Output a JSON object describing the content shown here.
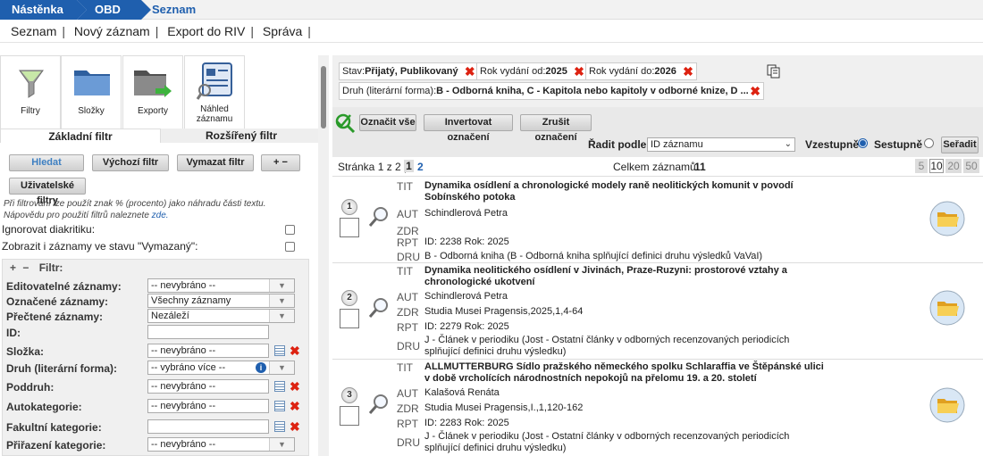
{
  "breadcrumb": [
    "Nástěnka",
    "OBD",
    "Seznam"
  ],
  "menu": [
    "Seznam",
    "Nový záznam",
    "Export do RIV",
    "Správa"
  ],
  "tiles": [
    {
      "label": "Filtry",
      "icon": "funnel-icon"
    },
    {
      "label": "Složky",
      "icon": "folder-icon"
    },
    {
      "label": "Exporty",
      "icon": "export-folder-icon"
    },
    {
      "label": "Náhled záznamu",
      "icon": "record-preview-icon"
    }
  ],
  "tabs": {
    "basic": "Základní filtr",
    "advanced": "Rozšířený filtr"
  },
  "buttons": {
    "search": "Hledat",
    "default_filter": "Výchozí filtr",
    "clear_filter": "Vymazat filtr",
    "plusminus": "+ −",
    "user_filters": "Uživatelské filtry"
  },
  "help": {
    "text": "Při filtrování lze použít znak % (procento) jako náhradu části textu. Nápovědu pro použití filtrů naleznete",
    "link": "zde."
  },
  "checks": [
    {
      "label": "Ignorovat diakritiku:"
    },
    {
      "label": "Zobrazit i záznamy ve stavu \"Vymazaný\":"
    }
  ],
  "filter_panel": {
    "title": "Filtr:",
    "rows": [
      {
        "label": "Editovatelné záznamy:",
        "value": "-- nevybráno --"
      },
      {
        "label": "Označené záznamy:",
        "value": "Všechny záznamy"
      },
      {
        "label": "Přečtené záznamy:",
        "value": "Nezáleží"
      },
      {
        "label": "ID:",
        "value": ""
      },
      {
        "label": "Složka:",
        "value": "-- nevybráno --"
      },
      {
        "label": "Druh (literární forma):",
        "value": "-- vybráno více --"
      },
      {
        "label": "Poddruh:",
        "value": "-- nevybráno --"
      },
      {
        "label": "Autokategorie:",
        "value": "-- nevybráno --"
      },
      {
        "label": "Fakultní kategorie:",
        "value": ""
      },
      {
        "label": "Přiřazení kategorie:",
        "value": "-- nevybráno --"
      }
    ]
  },
  "active_filters": [
    {
      "key": "Stav:",
      "value": "Přijatý, Publikovaný"
    },
    {
      "key": "Rok vydání od:",
      "value": "2025"
    },
    {
      "key": "Rok vydání do:",
      "value": "2026"
    },
    {
      "key": "Druh (literární forma):",
      "value": "B - Odborná kniha, C - Kapitola nebo kapitoly v odborné knize, D ..."
    }
  ],
  "actions": {
    "mark_all": "Označit vše",
    "invert": "Invertovat označení",
    "unmark": "Zrušit označení"
  },
  "sort": {
    "label": "Řadit podle:",
    "value": "ID záznamu",
    "asc": "Vzestupně",
    "desc": "Sestupně",
    "button": "Seřadit"
  },
  "pager": {
    "label": "Stránka 1 z 2 |",
    "pages": [
      "1",
      "2"
    ],
    "total_label": "Celkem záznamů:",
    "total": "11",
    "sizes": [
      "5",
      "10",
      "20",
      "50"
    ]
  },
  "records": [
    {
      "n": "1",
      "tit": "Dynamika osídlení a chronologické modely raně neolitických komunit v povodí Sobínského potoka",
      "aut": "Schindlerová Petra",
      "zdr": "",
      "rpt": "ID: 2238 Rok: 2025",
      "dru": "B - Odborná kniha  (B - Odborná kniha splňující definici druhu výsledků VaVaI)"
    },
    {
      "n": "2",
      "tit": "Dynamika neolitického osídlení v Jivinách, Praze-Ruzyni: prostorové vztahy a chronologické ukotvení",
      "aut": "Schindlerová Petra",
      "zdr": "Studia Musei Pragensis,2025,1,4-64",
      "rpt": "ID: 2279 Rok: 2025",
      "dru": "J - Článek v periodiku  (Jost - Ostatní články v odborných recenzovaných periodicích splňující definici druhu výsledku)"
    },
    {
      "n": "3",
      "tit": "ALLMUTTERBURG Sídlo pražského německého spolku Schlaraffia ve Štěpánské ulici v době vrcholících národnostních nepokojů na přelomu 19. a 20. století",
      "aut": "Kalašová Renáta",
      "zdr": "Studia Musei Pragensis,I.,1,120-162",
      "rpt": "ID: 2283 Rok: 2025",
      "dru": "J - Článek v periodiku  (Jost - Ostatní články v odborných recenzovaných periodicích splňující definici druhu výsledku)"
    }
  ],
  "field_labels": {
    "tit": "TIT",
    "aut": "AUT",
    "zdr": "ZDR",
    "rpt": "RPT",
    "dru": "DRU"
  }
}
